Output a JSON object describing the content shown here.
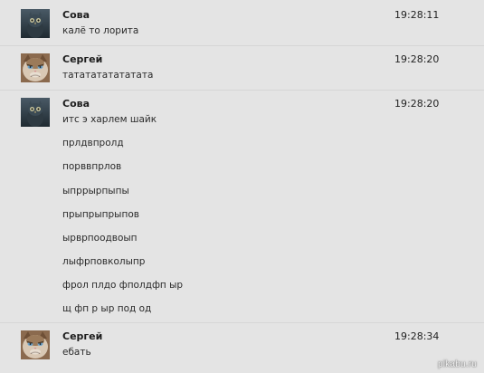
{
  "messages": [
    {
      "author": "Сова",
      "avatar": "owl-avatar",
      "time": "19:28:11",
      "lines": [
        "калё то лорита"
      ]
    },
    {
      "author": "Сергей",
      "avatar": "grumpy-cat-avatar",
      "time": "19:28:20",
      "lines": [
        "тататататататата"
      ]
    },
    {
      "author": "Сова",
      "avatar": "owl-avatar",
      "time": "19:28:20",
      "lines": [
        "итс э харлем шайк",
        "прлдвпролд",
        "порввпрлов",
        "ыпррырпыпы",
        "прыпрыпрыпов",
        "ырврпоодвоып",
        "лыфрповколыпр",
        "фрол плдо фполдфп ыр",
        "щ фп р ыр под од"
      ]
    },
    {
      "author": "Сергей",
      "avatar": "grumpy-cat-avatar",
      "time": "19:28:34",
      "lines": [
        "ебать"
      ]
    }
  ],
  "watermark": "pikabu.ru",
  "colors": {
    "background": "#e4e4e4",
    "author_text": "#1c1c1c",
    "message_text": "#2a2a2a"
  }
}
